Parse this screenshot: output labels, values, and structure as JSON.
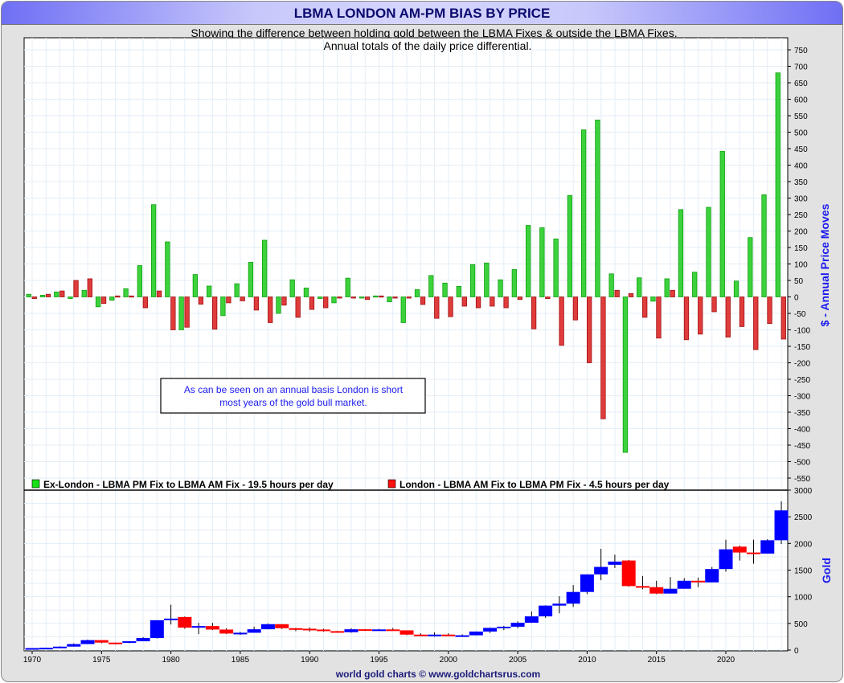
{
  "header": {
    "title": "LBMA LONDON AM-PM BIAS BY PRICE"
  },
  "subtitle1": "Showing the difference between holding gold between the LBMA Fixes & outside the LBMA Fixes.",
  "subtitle2": "Annual totals of the daily price differential.",
  "annotation": {
    "line1": "As can be seen on an annual basis London is short",
    "line2": "most years of the gold bull market."
  },
  "footer": "world gold charts © www.goldchartsrus.com",
  "colors": {
    "green": "#3cd23c",
    "red": "#e03c3c",
    "blue": "#0000ff",
    "candle_down": "#ff0000"
  },
  "chart_data": [
    {
      "type": "bar",
      "title": "LBMA LONDON AM-PM BIAS BY PRICE",
      "ylabel": "$ - Annual Price Moves",
      "ylim": [
        -550,
        750
      ],
      "yticks": [
        "750",
        "700",
        "650",
        "600",
        "550",
        "500",
        "450",
        "400",
        "350",
        "300",
        "250",
        "200",
        "150",
        "100",
        "50",
        "0",
        "-50",
        "-100",
        "-150",
        "-200",
        "-250",
        "-300",
        "-350",
        "-400",
        "-450",
        "-500",
        "-550"
      ],
      "x": [
        1970,
        1971,
        1972,
        1973,
        1974,
        1975,
        1976,
        1977,
        1978,
        1979,
        1980,
        1981,
        1982,
        1983,
        1984,
        1985,
        1986,
        1987,
        1988,
        1989,
        1990,
        1991,
        1992,
        1993,
        1994,
        1995,
        1996,
        1997,
        1998,
        1999,
        2000,
        2001,
        2002,
        2003,
        2004,
        2005,
        2006,
        2007,
        2008,
        2009,
        2010,
        2011,
        2012,
        2013,
        2014,
        2015,
        2016,
        2017,
        2018,
        2019,
        2020,
        2021,
        2022,
        2023,
        2024
      ],
      "legend_position": "bottom-left",
      "series": [
        {
          "name": "Ex-London - LBMA PM Fix to LBMA AM Fix - 19.5 hours per day",
          "values": [
            8,
            5,
            15,
            -5,
            20,
            -30,
            -10,
            25,
            95,
            280,
            167,
            -100,
            68,
            33,
            -57,
            40,
            105,
            172,
            -50,
            52,
            27,
            -5,
            -18,
            57,
            -3,
            3,
            -15,
            -78,
            22,
            65,
            42,
            32,
            98,
            103,
            52,
            83,
            217,
            210,
            176,
            308,
            507,
            537,
            70,
            -472,
            58,
            -13,
            55,
            265,
            75,
            272,
            442,
            48,
            180,
            310,
            680
          ]
        },
        {
          "name": "London - LBMA AM Fix to LBMA PM Fix - 4.5 hours per day",
          "values": [
            -5,
            8,
            18,
            50,
            55,
            -20,
            3,
            3,
            -33,
            18,
            -100,
            -92,
            -22,
            -98,
            -18,
            -12,
            -40,
            -78,
            -25,
            -62,
            -38,
            -33,
            -3,
            0,
            -8,
            3,
            -3,
            -3,
            -23,
            -65,
            -60,
            -28,
            -33,
            -28,
            -33,
            -8,
            -97,
            -5,
            -147,
            -70,
            -200,
            -370,
            20,
            10,
            -62,
            -125,
            20,
            -130,
            -113,
            -45,
            -122,
            -90,
            -160,
            -81,
            -128
          ]
        }
      ]
    },
    {
      "type": "candlestick",
      "ylabel": "Gold",
      "ylim": [
        0,
        3000
      ],
      "yticks": [
        "3000",
        "2500",
        "2000",
        "1500",
        "1000",
        "500",
        "0"
      ],
      "xticks": [
        "1970",
        "1975",
        "1980",
        "1985",
        "1990",
        "1995",
        "2000",
        "2005",
        "2010",
        "2015",
        "2020"
      ],
      "x": [
        1970,
        1971,
        1972,
        1973,
        1974,
        1975,
        1976,
        1977,
        1978,
        1979,
        1980,
        1981,
        1982,
        1983,
        1984,
        1985,
        1986,
        1987,
        1988,
        1989,
        1990,
        1991,
        1992,
        1993,
        1994,
        1995,
        1996,
        1997,
        1998,
        1999,
        2000,
        2001,
        2002,
        2003,
        2004,
        2005,
        2006,
        2007,
        2008,
        2009,
        2010,
        2011,
        2012,
        2013,
        2014,
        2015,
        2016,
        2017,
        2018,
        2019,
        2020,
        2021,
        2022,
        2023,
        2024
      ],
      "ohlc": [
        [
          35,
          37,
          35,
          37
        ],
        [
          37,
          44,
          37,
          43
        ],
        [
          44,
          70,
          44,
          64
        ],
        [
          65,
          127,
          64,
          112
        ],
        [
          112,
          195,
          112,
          186
        ],
        [
          186,
          186,
          128,
          140
        ],
        [
          140,
          140,
          103,
          134
        ],
        [
          134,
          168,
          129,
          165
        ],
        [
          165,
          243,
          165,
          226
        ],
        [
          226,
          560,
          216,
          560
        ],
        [
          560,
          850,
          480,
          590
        ],
        [
          620,
          630,
          400,
          420
        ],
        [
          420,
          510,
          300,
          450
        ],
        [
          450,
          510,
          375,
          385
        ],
        [
          385,
          410,
          300,
          310
        ],
        [
          310,
          340,
          285,
          325
        ],
        [
          325,
          440,
          325,
          390
        ],
        [
          390,
          500,
          390,
          485
        ],
        [
          485,
          485,
          395,
          410
        ],
        [
          410,
          415,
          355,
          400
        ],
        [
          400,
          425,
          345,
          385
        ],
        [
          385,
          400,
          345,
          355
        ],
        [
          355,
          360,
          330,
          335
        ],
        [
          335,
          410,
          325,
          390
        ],
        [
          390,
          395,
          370,
          380
        ],
        [
          380,
          395,
          370,
          387
        ],
        [
          387,
          415,
          367,
          370
        ],
        [
          370,
          370,
          280,
          290
        ],
        [
          290,
          315,
          275,
          288
        ],
        [
          288,
          330,
          250,
          290
        ],
        [
          290,
          315,
          265,
          273
        ],
        [
          273,
          295,
          255,
          277
        ],
        [
          277,
          350,
          275,
          347
        ],
        [
          347,
          420,
          320,
          416
        ],
        [
          416,
          455,
          375,
          438
        ],
        [
          438,
          540,
          410,
          513
        ],
        [
          513,
          725,
          510,
          632
        ],
        [
          632,
          840,
          605,
          834
        ],
        [
          834,
          1010,
          690,
          870
        ],
        [
          870,
          1220,
          810,
          1090
        ],
        [
          1090,
          1420,
          1050,
          1420
        ],
        [
          1420,
          1900,
          1310,
          1560
        ],
        [
          1600,
          1790,
          1540,
          1660
        ],
        [
          1680,
          1690,
          1190,
          1200
        ],
        [
          1200,
          1390,
          1140,
          1180
        ],
        [
          1180,
          1300,
          1050,
          1060
        ],
        [
          1060,
          1370,
          1060,
          1150
        ],
        [
          1150,
          1350,
          1150,
          1300
        ],
        [
          1300,
          1360,
          1180,
          1270
        ],
        [
          1270,
          1560,
          1270,
          1520
        ],
        [
          1520,
          2070,
          1470,
          1890
        ],
        [
          1940,
          1960,
          1680,
          1830
        ],
        [
          1830,
          2070,
          1620,
          1810
        ],
        [
          1810,
          2080,
          1810,
          2060
        ],
        [
          2060,
          2790,
          1990,
          2620
        ]
      ]
    }
  ]
}
